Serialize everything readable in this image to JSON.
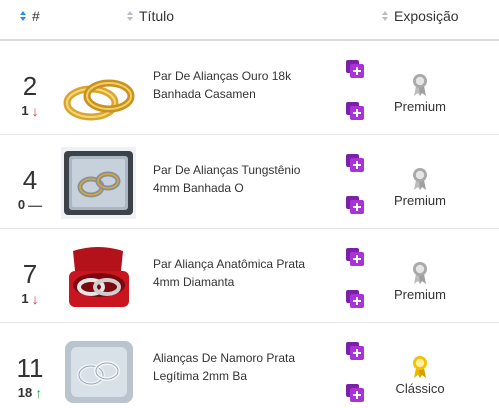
{
  "header": {
    "rank_label": "#",
    "title_label": "Título",
    "exposure_label": "Exposição"
  },
  "rows": [
    {
      "rank": "2",
      "delta": "1",
      "trend": "down",
      "title": "Par De Alianças Ouro 18k Banhada Casamen",
      "exposure": "Premium",
      "medal": "silver"
    },
    {
      "rank": "4",
      "delta": "0",
      "trend": "same",
      "title": "Par De Alianças Tungstênio 4mm Banhada O",
      "exposure": "Premium",
      "medal": "silver"
    },
    {
      "rank": "7",
      "delta": "1",
      "trend": "down",
      "title": "Par Aliança Anatômica Prata 4mm Diamanta",
      "exposure": "Premium",
      "medal": "silver"
    },
    {
      "rank": "11",
      "delta": "18",
      "trend": "up",
      "title": "Alianças De Namoro Prata Legítima 2mm Ba",
      "exposure": "Clássico",
      "medal": "gold"
    }
  ],
  "colors": {
    "add_button": "#a933d6",
    "arrow_down": "#e0342c",
    "arrow_up": "#2aa34b",
    "medal_silver": "#a9a9a9",
    "medal_gold": "#f2c200",
    "sort_active": "#2e8de5"
  }
}
